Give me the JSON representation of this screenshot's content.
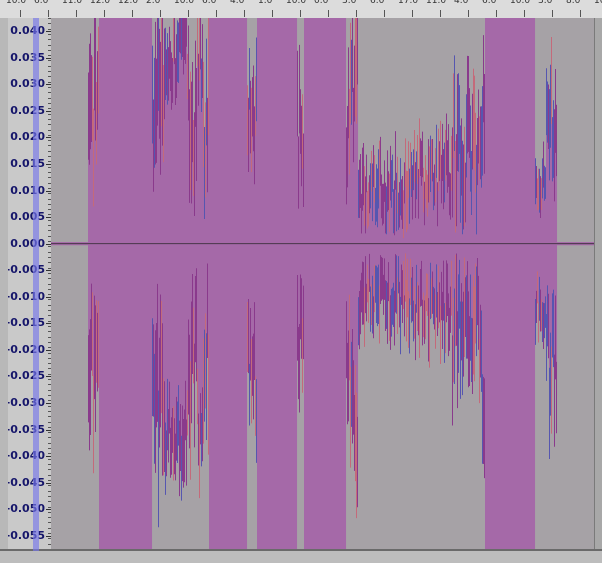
{
  "window": {
    "name": "audio-editor-waveform-view"
  },
  "colors": {
    "background": "#a6a2a6",
    "waveform_fill": "#a569a8",
    "waveform_peak": "#8a3a8c",
    "waveform_rms_hint": "#c46a7a",
    "waveform_blue": "#5656b0",
    "axis_text": "#15156a",
    "playhead": "#7878eb",
    "center_line": "#222222"
  },
  "ruler": {
    "labels": [
      "10.0",
      "6.0",
      "11.0",
      "12.0",
      "12.0",
      "2.0",
      "10.0",
      "6.0",
      "4.0",
      "1.0",
      "10.0",
      "0.0",
      "3.0",
      "6.0",
      "17.0",
      "11.0",
      "4.0",
      "6.0",
      "10.0",
      "3.0",
      "8.0",
      "10.0"
    ]
  },
  "amplitude_scale": {
    "labels": [
      "0.040",
      "0.035",
      "0.030",
      "0.025",
      "0.020",
      "0.015",
      "0.010",
      "0.005",
      "0.000",
      "-0.005",
      "-0.010",
      "-0.015",
      "-0.020",
      "-0.025",
      "-0.030",
      "-0.035",
      "-0.040",
      "-0.045",
      "-0.050",
      "-0.055"
    ]
  },
  "waveform": {
    "amplitude_range": [
      -0.0575,
      0.0425
    ],
    "segments": [
      {
        "from": 0.0,
        "to": 0.067,
        "level": 0.0003
      },
      {
        "from": 0.067,
        "to": 0.086,
        "level": 0.024,
        "jag": 0.01
      },
      {
        "from": 0.086,
        "to": 0.183,
        "level": 0.06
      },
      {
        "from": 0.183,
        "to": 0.207,
        "level": 0.026,
        "jag": 0.012
      },
      {
        "from": 0.207,
        "to": 0.249,
        "level": 0.036,
        "jag": 0.006
      },
      {
        "from": 0.249,
        "to": 0.265,
        "level": 0.022,
        "jag": 0.01
      },
      {
        "from": 0.265,
        "to": 0.276,
        "level": 0.034,
        "jag": 0.006
      },
      {
        "from": 0.276,
        "to": 0.287,
        "level": 0.02,
        "jag": 0.01
      },
      {
        "from": 0.287,
        "to": 0.357,
        "level": 0.06
      },
      {
        "from": 0.357,
        "to": 0.375,
        "level": 0.024,
        "jag": 0.008
      },
      {
        "from": 0.375,
        "to": 0.448,
        "level": 0.06
      },
      {
        "from": 0.448,
        "to": 0.46,
        "level": 0.02,
        "jag": 0.008
      },
      {
        "from": 0.46,
        "to": 0.537,
        "level": 0.06
      },
      {
        "from": 0.537,
        "to": 0.544,
        "level": 0.02,
        "jag": 0.008
      },
      {
        "from": 0.544,
        "to": 0.559,
        "level": 0.032,
        "jag": 0.01
      },
      {
        "from": 0.559,
        "to": 0.654,
        "level": 0.01,
        "jag": 0.005
      },
      {
        "from": 0.654,
        "to": 0.73,
        "level": 0.012,
        "jag": 0.005
      },
      {
        "from": 0.73,
        "to": 0.778,
        "level": 0.016,
        "jag": 0.008
      },
      {
        "from": 0.778,
        "to": 0.79,
        "level": 0.024,
        "jag": 0.008
      },
      {
        "from": 0.79,
        "to": 0.88,
        "level": 0.06
      },
      {
        "from": 0.88,
        "to": 0.9,
        "level": 0.012,
        "jag": 0.004
      },
      {
        "from": 0.9,
        "to": 0.92,
        "level": 0.022,
        "jag": 0.008
      },
      {
        "from": 0.92,
        "to": 1.0,
        "level": 0.0003
      }
    ]
  }
}
